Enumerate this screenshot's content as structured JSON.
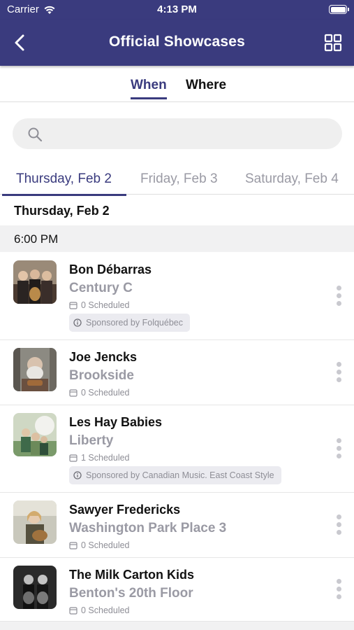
{
  "status_bar": {
    "carrier": "Carrier",
    "time": "4:13 PM"
  },
  "nav": {
    "title": "Official Showcases"
  },
  "segments": [
    {
      "label": "When",
      "active": true
    },
    {
      "label": "Where",
      "active": false
    }
  ],
  "search": {
    "placeholder": ""
  },
  "day_tabs": [
    {
      "label": "Thursday, Feb 2",
      "active": true
    },
    {
      "label": "Friday, Feb 3",
      "active": false
    },
    {
      "label": "Saturday, Feb 4",
      "active": false
    }
  ],
  "section": {
    "date": "Thursday, Feb 2",
    "time": "6:00 PM"
  },
  "showcases": [
    {
      "name": "Bon Débarras",
      "venue": "Century C",
      "scheduled": "0 Scheduled",
      "sponsor": "Sponsored by Folquébec"
    },
    {
      "name": "Joe Jencks",
      "venue": "Brookside",
      "scheduled": "0 Scheduled",
      "sponsor": ""
    },
    {
      "name": "Les Hay Babies",
      "venue": "Liberty",
      "scheduled": "1 Scheduled",
      "sponsor": "Sponsored by Canadian Music. East Coast Style"
    },
    {
      "name": "Sawyer Fredericks",
      "venue": "Washington Park Place 3",
      "scheduled": "0 Scheduled",
      "sponsor": ""
    },
    {
      "name": "The Milk Carton Kids",
      "venue": "Benton's 20th Floor",
      "scheduled": "0 Scheduled",
      "sponsor": ""
    }
  ],
  "colors": {
    "brand": "#3a3b7e",
    "muted": "#9a9aa4",
    "section_bg": "#f1f1f2"
  }
}
